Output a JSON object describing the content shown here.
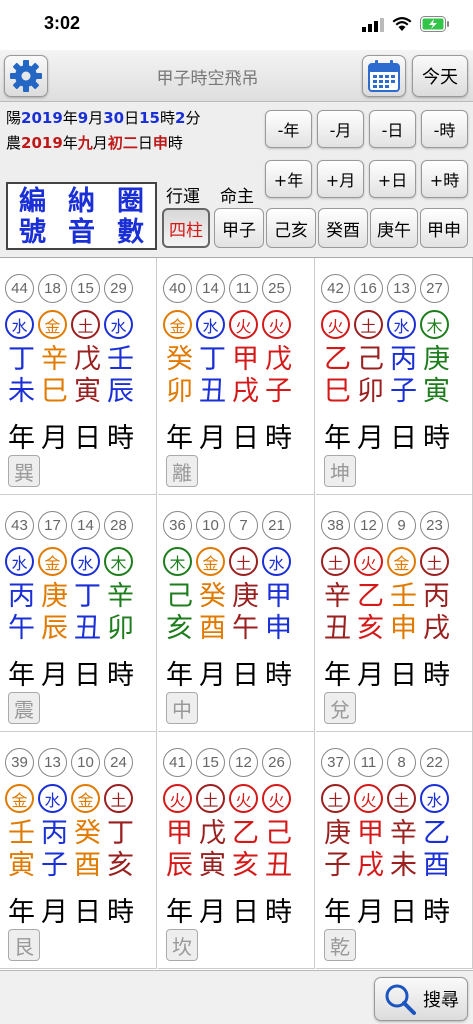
{
  "status": {
    "time": "3:02"
  },
  "toolbar": {
    "title": "甲子時空飛吊",
    "today_label": "今天"
  },
  "dates": {
    "solar": {
      "prefix": "陽",
      "year": "2019",
      "y": "年",
      "month": "9",
      "m": "月",
      "day": "30",
      "d": "日",
      "hour": "15",
      "h": "時",
      "minute": "2",
      "mi": "分"
    },
    "lunar": {
      "prefix": "農",
      "year": "2019",
      "y": "年",
      "month": "九",
      "m": "月",
      "day": "初二",
      "d": "日",
      "hour": "申",
      "h": "時"
    }
  },
  "nav": {
    "row1": [
      "-年",
      "-月",
      "-日",
      "-時"
    ],
    "row2": [
      "+年",
      "+月",
      "+日",
      "+時"
    ]
  },
  "mode": {
    "cols": [
      "編號",
      "納音",
      "圈數"
    ]
  },
  "labels": {
    "xingyun": "行運",
    "mingzhu": "命主"
  },
  "pillars": [
    "四柱",
    "甲子",
    "己亥",
    "癸酉",
    "庚午",
    "甲申"
  ],
  "positions": [
    "年",
    "月",
    "日",
    "時"
  ],
  "colors": {
    "water": "#1a2fd6",
    "metal": "#e07a00",
    "fire": "#d51818",
    "earth": "#9a1f1f",
    "wood": "#1d7d1d"
  },
  "cells": [
    {
      "nums": [
        "44",
        "18",
        "15",
        "29"
      ],
      "elements": [
        {
          "t": "水",
          "c": "water"
        },
        {
          "t": "金",
          "c": "metal"
        },
        {
          "t": "土",
          "c": "earth"
        },
        {
          "t": "水",
          "c": "water"
        }
      ],
      "stems": [
        {
          "t": "丁",
          "c": "water"
        },
        {
          "t": "辛",
          "c": "metal"
        },
        {
          "t": "戊",
          "c": "earth"
        },
        {
          "t": "壬",
          "c": "water"
        }
      ],
      "branches": [
        {
          "t": "未",
          "c": "water"
        },
        {
          "t": "巳",
          "c": "metal"
        },
        {
          "t": "寅",
          "c": "earth"
        },
        {
          "t": "辰",
          "c": "water"
        }
      ],
      "trigram": "巽"
    },
    {
      "nums": [
        "40",
        "14",
        "11",
        "25"
      ],
      "elements": [
        {
          "t": "金",
          "c": "metal"
        },
        {
          "t": "水",
          "c": "water"
        },
        {
          "t": "火",
          "c": "fire"
        },
        {
          "t": "火",
          "c": "fire"
        }
      ],
      "stems": [
        {
          "t": "癸",
          "c": "metal"
        },
        {
          "t": "丁",
          "c": "water"
        },
        {
          "t": "甲",
          "c": "fire"
        },
        {
          "t": "戊",
          "c": "fire"
        }
      ],
      "branches": [
        {
          "t": "卯",
          "c": "metal"
        },
        {
          "t": "丑",
          "c": "water"
        },
        {
          "t": "戌",
          "c": "fire"
        },
        {
          "t": "子",
          "c": "fire"
        }
      ],
      "trigram": "離"
    },
    {
      "nums": [
        "42",
        "16",
        "13",
        "27"
      ],
      "elements": [
        {
          "t": "火",
          "c": "fire"
        },
        {
          "t": "土",
          "c": "earth"
        },
        {
          "t": "水",
          "c": "water"
        },
        {
          "t": "木",
          "c": "wood"
        }
      ],
      "stems": [
        {
          "t": "乙",
          "c": "fire"
        },
        {
          "t": "己",
          "c": "earth"
        },
        {
          "t": "丙",
          "c": "water"
        },
        {
          "t": "庚",
          "c": "wood"
        }
      ],
      "branches": [
        {
          "t": "巳",
          "c": "fire"
        },
        {
          "t": "卯",
          "c": "earth"
        },
        {
          "t": "子",
          "c": "water"
        },
        {
          "t": "寅",
          "c": "wood"
        }
      ],
      "trigram": "坤"
    },
    {
      "nums": [
        "43",
        "17",
        "14",
        "28"
      ],
      "elements": [
        {
          "t": "水",
          "c": "water"
        },
        {
          "t": "金",
          "c": "metal"
        },
        {
          "t": "水",
          "c": "water"
        },
        {
          "t": "木",
          "c": "wood"
        }
      ],
      "stems": [
        {
          "t": "丙",
          "c": "water"
        },
        {
          "t": "庚",
          "c": "metal"
        },
        {
          "t": "丁",
          "c": "water"
        },
        {
          "t": "辛",
          "c": "wood"
        }
      ],
      "branches": [
        {
          "t": "午",
          "c": "water"
        },
        {
          "t": "辰",
          "c": "metal"
        },
        {
          "t": "丑",
          "c": "water"
        },
        {
          "t": "卯",
          "c": "wood"
        }
      ],
      "trigram": "震"
    },
    {
      "nums": [
        "36",
        "10",
        "7",
        "21"
      ],
      "elements": [
        {
          "t": "木",
          "c": "wood"
        },
        {
          "t": "金",
          "c": "metal"
        },
        {
          "t": "土",
          "c": "earth"
        },
        {
          "t": "水",
          "c": "water"
        }
      ],
      "stems": [
        {
          "t": "己",
          "c": "wood"
        },
        {
          "t": "癸",
          "c": "metal"
        },
        {
          "t": "庚",
          "c": "earth"
        },
        {
          "t": "甲",
          "c": "water"
        }
      ],
      "branches": [
        {
          "t": "亥",
          "c": "wood"
        },
        {
          "t": "酉",
          "c": "metal"
        },
        {
          "t": "午",
          "c": "earth"
        },
        {
          "t": "申",
          "c": "water"
        }
      ],
      "trigram": "中"
    },
    {
      "nums": [
        "38",
        "12",
        "9",
        "23"
      ],
      "elements": [
        {
          "t": "土",
          "c": "earth"
        },
        {
          "t": "火",
          "c": "fire"
        },
        {
          "t": "金",
          "c": "metal"
        },
        {
          "t": "土",
          "c": "earth"
        }
      ],
      "stems": [
        {
          "t": "辛",
          "c": "earth"
        },
        {
          "t": "乙",
          "c": "fire"
        },
        {
          "t": "壬",
          "c": "metal"
        },
        {
          "t": "丙",
          "c": "earth"
        }
      ],
      "branches": [
        {
          "t": "丑",
          "c": "earth"
        },
        {
          "t": "亥",
          "c": "fire"
        },
        {
          "t": "申",
          "c": "metal"
        },
        {
          "t": "戌",
          "c": "earth"
        }
      ],
      "trigram": "兌"
    },
    {
      "nums": [
        "39",
        "13",
        "10",
        "24"
      ],
      "elements": [
        {
          "t": "金",
          "c": "metal"
        },
        {
          "t": "水",
          "c": "water"
        },
        {
          "t": "金",
          "c": "metal"
        },
        {
          "t": "土",
          "c": "earth"
        }
      ],
      "stems": [
        {
          "t": "壬",
          "c": "metal"
        },
        {
          "t": "丙",
          "c": "water"
        },
        {
          "t": "癸",
          "c": "metal"
        },
        {
          "t": "丁",
          "c": "earth"
        }
      ],
      "branches": [
        {
          "t": "寅",
          "c": "metal"
        },
        {
          "t": "子",
          "c": "water"
        },
        {
          "t": "酉",
          "c": "metal"
        },
        {
          "t": "亥",
          "c": "earth"
        }
      ],
      "trigram": "艮"
    },
    {
      "nums": [
        "41",
        "15",
        "12",
        "26"
      ],
      "elements": [
        {
          "t": "火",
          "c": "fire"
        },
        {
          "t": "土",
          "c": "earth"
        },
        {
          "t": "火",
          "c": "fire"
        },
        {
          "t": "火",
          "c": "fire"
        }
      ],
      "stems": [
        {
          "t": "甲",
          "c": "fire"
        },
        {
          "t": "戊",
          "c": "earth"
        },
        {
          "t": "乙",
          "c": "fire"
        },
        {
          "t": "己",
          "c": "fire"
        }
      ],
      "branches": [
        {
          "t": "辰",
          "c": "fire"
        },
        {
          "t": "寅",
          "c": "earth"
        },
        {
          "t": "亥",
          "c": "fire"
        },
        {
          "t": "丑",
          "c": "fire"
        }
      ],
      "trigram": "坎"
    },
    {
      "nums": [
        "37",
        "11",
        "8",
        "22"
      ],
      "elements": [
        {
          "t": "土",
          "c": "earth"
        },
        {
          "t": "火",
          "c": "fire"
        },
        {
          "t": "土",
          "c": "earth"
        },
        {
          "t": "水",
          "c": "water"
        }
      ],
      "stems": [
        {
          "t": "庚",
          "c": "earth"
        },
        {
          "t": "甲",
          "c": "fire"
        },
        {
          "t": "辛",
          "c": "earth"
        },
        {
          "t": "乙",
          "c": "water"
        }
      ],
      "branches": [
        {
          "t": "子",
          "c": "earth"
        },
        {
          "t": "戌",
          "c": "fire"
        },
        {
          "t": "未",
          "c": "earth"
        },
        {
          "t": "酉",
          "c": "water"
        }
      ],
      "trigram": "乾"
    }
  ],
  "search": {
    "label": "搜尋"
  }
}
